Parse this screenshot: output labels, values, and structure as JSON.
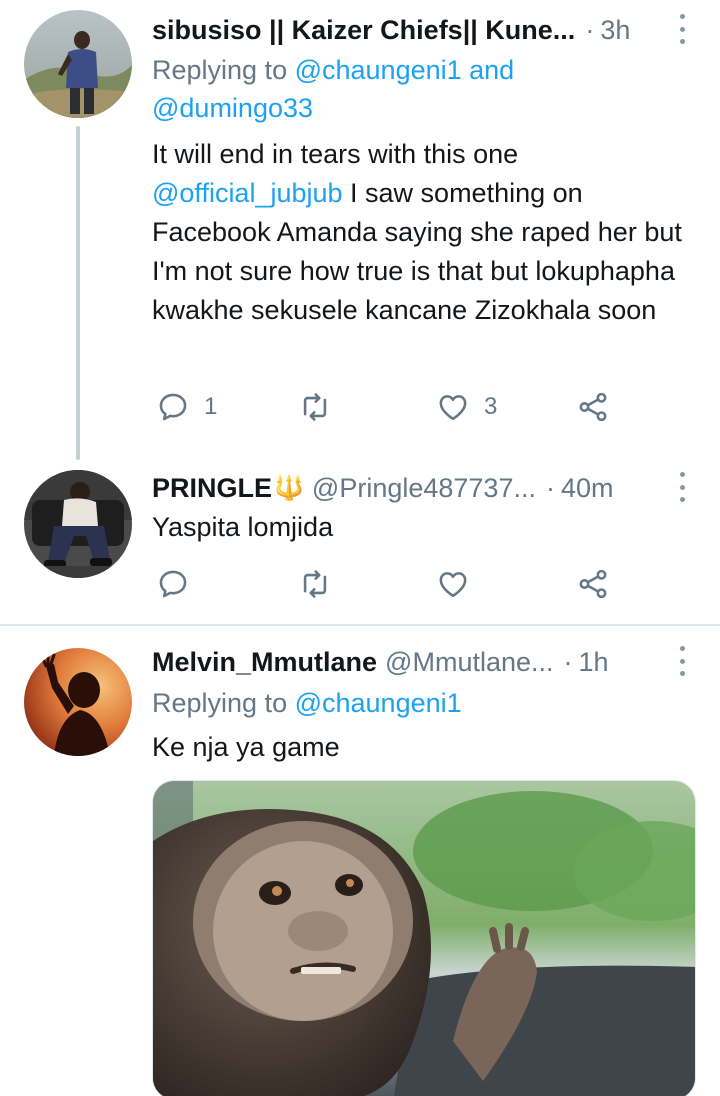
{
  "tweets": [
    {
      "name": "sibusiso || Kaizer Chiefs|| Kune...",
      "handle": "",
      "dot": "·",
      "time": "3h",
      "replying_prefix": "Replying to ",
      "replying_to_1": "@chaungeni1",
      "replying_and": " and",
      "replying_to_2": "@dumingo33",
      "text_line1": "It will end in tears with this one",
      "text_mention": "@official_jubjub",
      "text_after_mention": " I saw something on Facebook Amanda saying she raped her but I'm not sure how true is that but lokuphapha kwakhe sekusele kancane Zizokhala soon",
      "reply_count": "1",
      "retweet_count": "",
      "like_count": "3"
    },
    {
      "name": "PRINGLE",
      "name_emoji": "🔱",
      "handle": "@Pringle487737...",
      "dot": "·",
      "time": "40m",
      "text": "Yaspita lomjida",
      "reply_count": "",
      "retweet_count": "",
      "like_count": ""
    },
    {
      "name": "Melvin_Mmutlane",
      "handle": "@Mmutlane...",
      "dot": "·",
      "time": "1h",
      "replying_prefix": "Replying to ",
      "replying_to_1": "@chaungeni1",
      "text": "Ke nja ya game"
    }
  ],
  "icons": {
    "reply": "reply-icon",
    "retweet": "retweet-icon",
    "like": "heart-icon",
    "share": "share-icon",
    "more": "more-vertical-icon"
  },
  "colors": {
    "accent": "#1da1f2",
    "secondary_text": "#657786",
    "divider": "#e1e8ed"
  }
}
